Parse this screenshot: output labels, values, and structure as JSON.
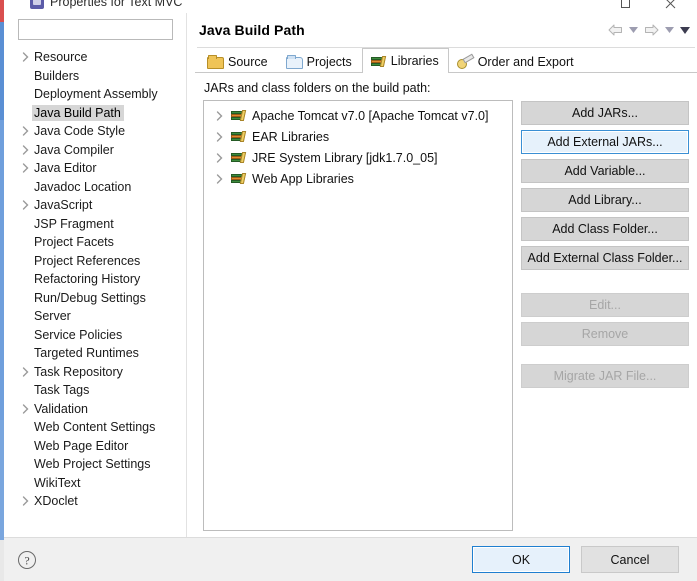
{
  "window": {
    "title": "Properties for Text MVC",
    "icon": "properties-window-icon",
    "maximize_label": "Maximize",
    "close_label": "Close"
  },
  "sidebar": {
    "filter_value": "",
    "filter_placeholder": "",
    "items": [
      {
        "label": "Resource",
        "expandable": true,
        "selected": false
      },
      {
        "label": "Builders",
        "expandable": false,
        "selected": false
      },
      {
        "label": "Deployment Assembly",
        "expandable": false,
        "selected": false
      },
      {
        "label": "Java Build Path",
        "expandable": false,
        "selected": true
      },
      {
        "label": "Java Code Style",
        "expandable": true,
        "selected": false
      },
      {
        "label": "Java Compiler",
        "expandable": true,
        "selected": false
      },
      {
        "label": "Java Editor",
        "expandable": true,
        "selected": false
      },
      {
        "label": "Javadoc Location",
        "expandable": false,
        "selected": false
      },
      {
        "label": "JavaScript",
        "expandable": true,
        "selected": false
      },
      {
        "label": "JSP Fragment",
        "expandable": false,
        "selected": false
      },
      {
        "label": "Project Facets",
        "expandable": false,
        "selected": false
      },
      {
        "label": "Project References",
        "expandable": false,
        "selected": false
      },
      {
        "label": "Refactoring History",
        "expandable": false,
        "selected": false
      },
      {
        "label": "Run/Debug Settings",
        "expandable": false,
        "selected": false
      },
      {
        "label": "Server",
        "expandable": false,
        "selected": false
      },
      {
        "label": "Service Policies",
        "expandable": false,
        "selected": false
      },
      {
        "label": "Targeted Runtimes",
        "expandable": false,
        "selected": false
      },
      {
        "label": "Task Repository",
        "expandable": true,
        "selected": false
      },
      {
        "label": "Task Tags",
        "expandable": false,
        "selected": false
      },
      {
        "label": "Validation",
        "expandable": true,
        "selected": false
      },
      {
        "label": "Web Content Settings",
        "expandable": false,
        "selected": false
      },
      {
        "label": "Web Page Editor",
        "expandable": false,
        "selected": false
      },
      {
        "label": "Web Project Settings",
        "expandable": false,
        "selected": false
      },
      {
        "label": "WikiText",
        "expandable": false,
        "selected": false
      },
      {
        "label": "XDoclet",
        "expandable": true,
        "selected": false
      }
    ]
  },
  "page": {
    "title": "Java Build Path",
    "nav": {
      "back_icon": "back-arrow-icon",
      "back_menu_icon": "chevron-down-icon",
      "forward_icon": "forward-arrow-icon",
      "forward_menu_icon": "chevron-down-icon",
      "menu_icon": "chevron-down-icon"
    },
    "tabs": [
      {
        "label": "Source",
        "icon": "source-folder-icon",
        "active": false
      },
      {
        "label": "Projects",
        "icon": "projects-folder-icon",
        "active": false
      },
      {
        "label": "Libraries",
        "icon": "libraries-books-icon",
        "active": true
      },
      {
        "label": "Order and Export",
        "icon": "order-export-icon",
        "active": false
      }
    ],
    "libraries_tab": {
      "list_label": "JARs and class folders on the build path:",
      "entries": [
        {
          "label": "Apache Tomcat v7.0 [Apache Tomcat v7.0]",
          "icon": "library-icon",
          "expandable": true
        },
        {
          "label": "EAR Libraries",
          "icon": "library-icon",
          "expandable": true
        },
        {
          "label": "JRE System Library [jdk1.7.0_05]",
          "icon": "library-icon",
          "expandable": true
        },
        {
          "label": "Web App Libraries",
          "icon": "library-icon",
          "expandable": true
        }
      ],
      "buttons": [
        {
          "label": "Add JARs...",
          "state": "normal"
        },
        {
          "label": "Add External JARs...",
          "state": "focused"
        },
        {
          "label": "Add Variable...",
          "state": "normal"
        },
        {
          "label": "Add Library...",
          "state": "normal"
        },
        {
          "label": "Add Class Folder...",
          "state": "normal"
        },
        {
          "label": "Add External Class Folder...",
          "state": "normal"
        },
        {
          "label": "Edit...",
          "state": "disabled"
        },
        {
          "label": "Remove",
          "state": "disabled"
        },
        {
          "label": "Migrate JAR File...",
          "state": "disabled"
        }
      ]
    }
  },
  "footer": {
    "help_icon": "help-question-icon",
    "ok_label": "OK",
    "cancel_label": "Cancel"
  },
  "colors": {
    "accent": "#1f7fd0",
    "focus_fill": "#e6f1fb",
    "selection": "#d6d6d6",
    "button_face": "#d6d6d6",
    "dialog_bg": "#f0f0f0"
  }
}
